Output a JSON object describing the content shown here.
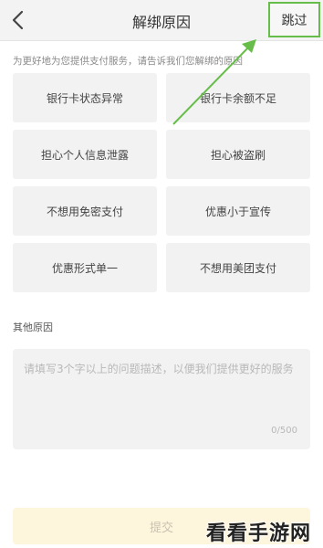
{
  "header": {
    "title": "解绑原因",
    "skip_label": "跳过"
  },
  "hint": "为更好地为您提供支付服务，请告诉我们您解绑的原因",
  "options": [
    "银行卡状态异常",
    "银行卡余额不足",
    "担心个人信息泄露",
    "担心被盗刷",
    "不想用免密支付",
    "优惠小于宣传",
    "优惠形式单一",
    "不想用美团支付"
  ],
  "other": {
    "label": "其他原因",
    "placeholder": "请填写3个字以上的问题描述，以便我们提供更好的服务",
    "counter": "0/500"
  },
  "submit_label": "提交",
  "watermark": "看看手游网",
  "colors": {
    "highlight": "#67bd49",
    "submit_bg": "#fdf5dc"
  }
}
